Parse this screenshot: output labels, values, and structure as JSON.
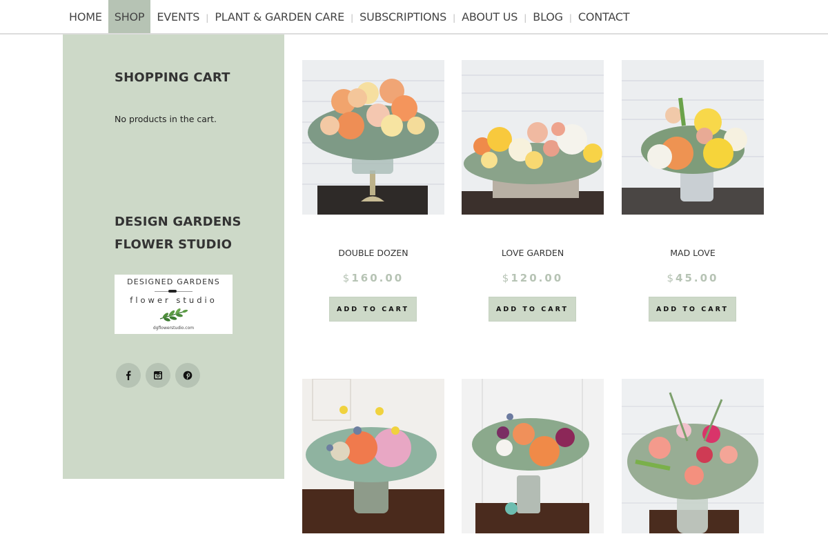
{
  "nav": {
    "items": [
      {
        "label": "HOME",
        "active": false
      },
      {
        "label": "SHOP",
        "active": true
      },
      {
        "label": "EVENTS",
        "active": false
      },
      {
        "label": "PLANT & GARDEN CARE",
        "active": false
      },
      {
        "label": "SUBSCRIPTIONS",
        "active": false
      },
      {
        "label": "ABOUT US",
        "active": false
      },
      {
        "label": "BLOG",
        "active": false
      },
      {
        "label": "CONTACT",
        "active": false
      }
    ],
    "separator": "|"
  },
  "sidebar": {
    "cart_title": "SHOPPING CART",
    "cart_empty": "No products in the cart.",
    "studio_title_line1": "DESIGN GARDENS",
    "studio_title_line2": "FLOWER STUDIO",
    "logo": {
      "top": "DESIGNED GARDENS",
      "sub": "flower studio",
      "url": "dgflowerstudio.com"
    },
    "socials": [
      {
        "name": "facebook-icon",
        "glyph": "f"
      },
      {
        "name": "instagram-icon"
      },
      {
        "name": "pinterest-icon"
      }
    ]
  },
  "colors": {
    "accent": "#b6c3b4",
    "sidebar_bg": "#cdd9c8",
    "button_bg": "#cdd9c8",
    "price": "#b6c3b4"
  },
  "products": [
    {
      "name": "DOUBLE DOZEN",
      "currency": "$",
      "price": "160.00",
      "button": "ADD TO CART",
      "image": "peach-yellow-roses-pedestal-vase"
    },
    {
      "name": "LOVE GARDEN",
      "currency": "$",
      "price": "120.00",
      "button": "ADD TO CART",
      "image": "roses-hydrangea-wooden-box"
    },
    {
      "name": "MAD LOVE",
      "currency": "$",
      "price": "45.00",
      "button": "ADD TO CART",
      "image": "orange-yellow-roses-mercury-vase"
    },
    {
      "name": "",
      "currency": "",
      "price": "",
      "button": "",
      "image": "orange-rose-hydrangea-craspedia-jar"
    },
    {
      "name": "",
      "currency": "",
      "price": "",
      "button": "",
      "image": "orange-rose-thistle-bouquet-jar"
    },
    {
      "name": "",
      "currency": "",
      "price": "",
      "button": "",
      "image": "carnation-wildflower-pitcher"
    }
  ]
}
